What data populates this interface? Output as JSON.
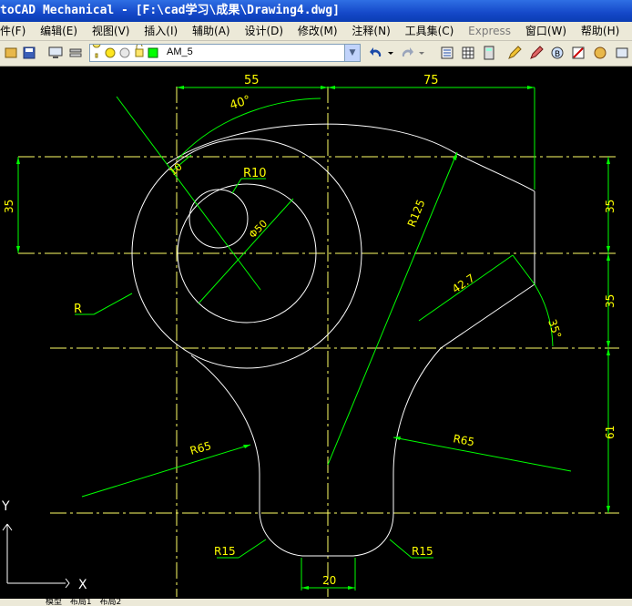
{
  "window": {
    "title": "toCAD Mechanical - [F:\\cad学习\\成果\\Drawing4.dwg]"
  },
  "menu": [
    "件(F)",
    "编辑(E)",
    "视图(V)",
    "插入(I)",
    "辅助(A)",
    "设计(D)",
    "修改(M)",
    "注释(N)",
    "工具集(C)",
    "Express",
    "窗口(W)",
    "帮助(H)"
  ],
  "toolbar": {
    "layer_name": "AM_5"
  },
  "dimensions": {
    "d55": "55",
    "d75": "75",
    "a40": "40°",
    "d10": "10",
    "r10": "R10",
    "phi50": "Φ50",
    "r125": "R125",
    "d35_left": "35",
    "d35_right_top": "35",
    "d35_right_mid": "35",
    "d61": "61",
    "d42_7": "42.7",
    "a35": "35°",
    "r": "R",
    "r65_left": "R65",
    "r65_right": "R65",
    "r15_left": "R15",
    "r15_right": "R15",
    "d20": "20"
  },
  "ucs": {
    "x": "X",
    "y": "Y"
  },
  "tabs": [
    "模型",
    "布局1",
    "布局2"
  ],
  "colors": {
    "background": "#000000",
    "geometry": "#ffffff",
    "dimension": "#00ff00",
    "dim_text": "#ffff00",
    "centerline": "#ffff66"
  }
}
